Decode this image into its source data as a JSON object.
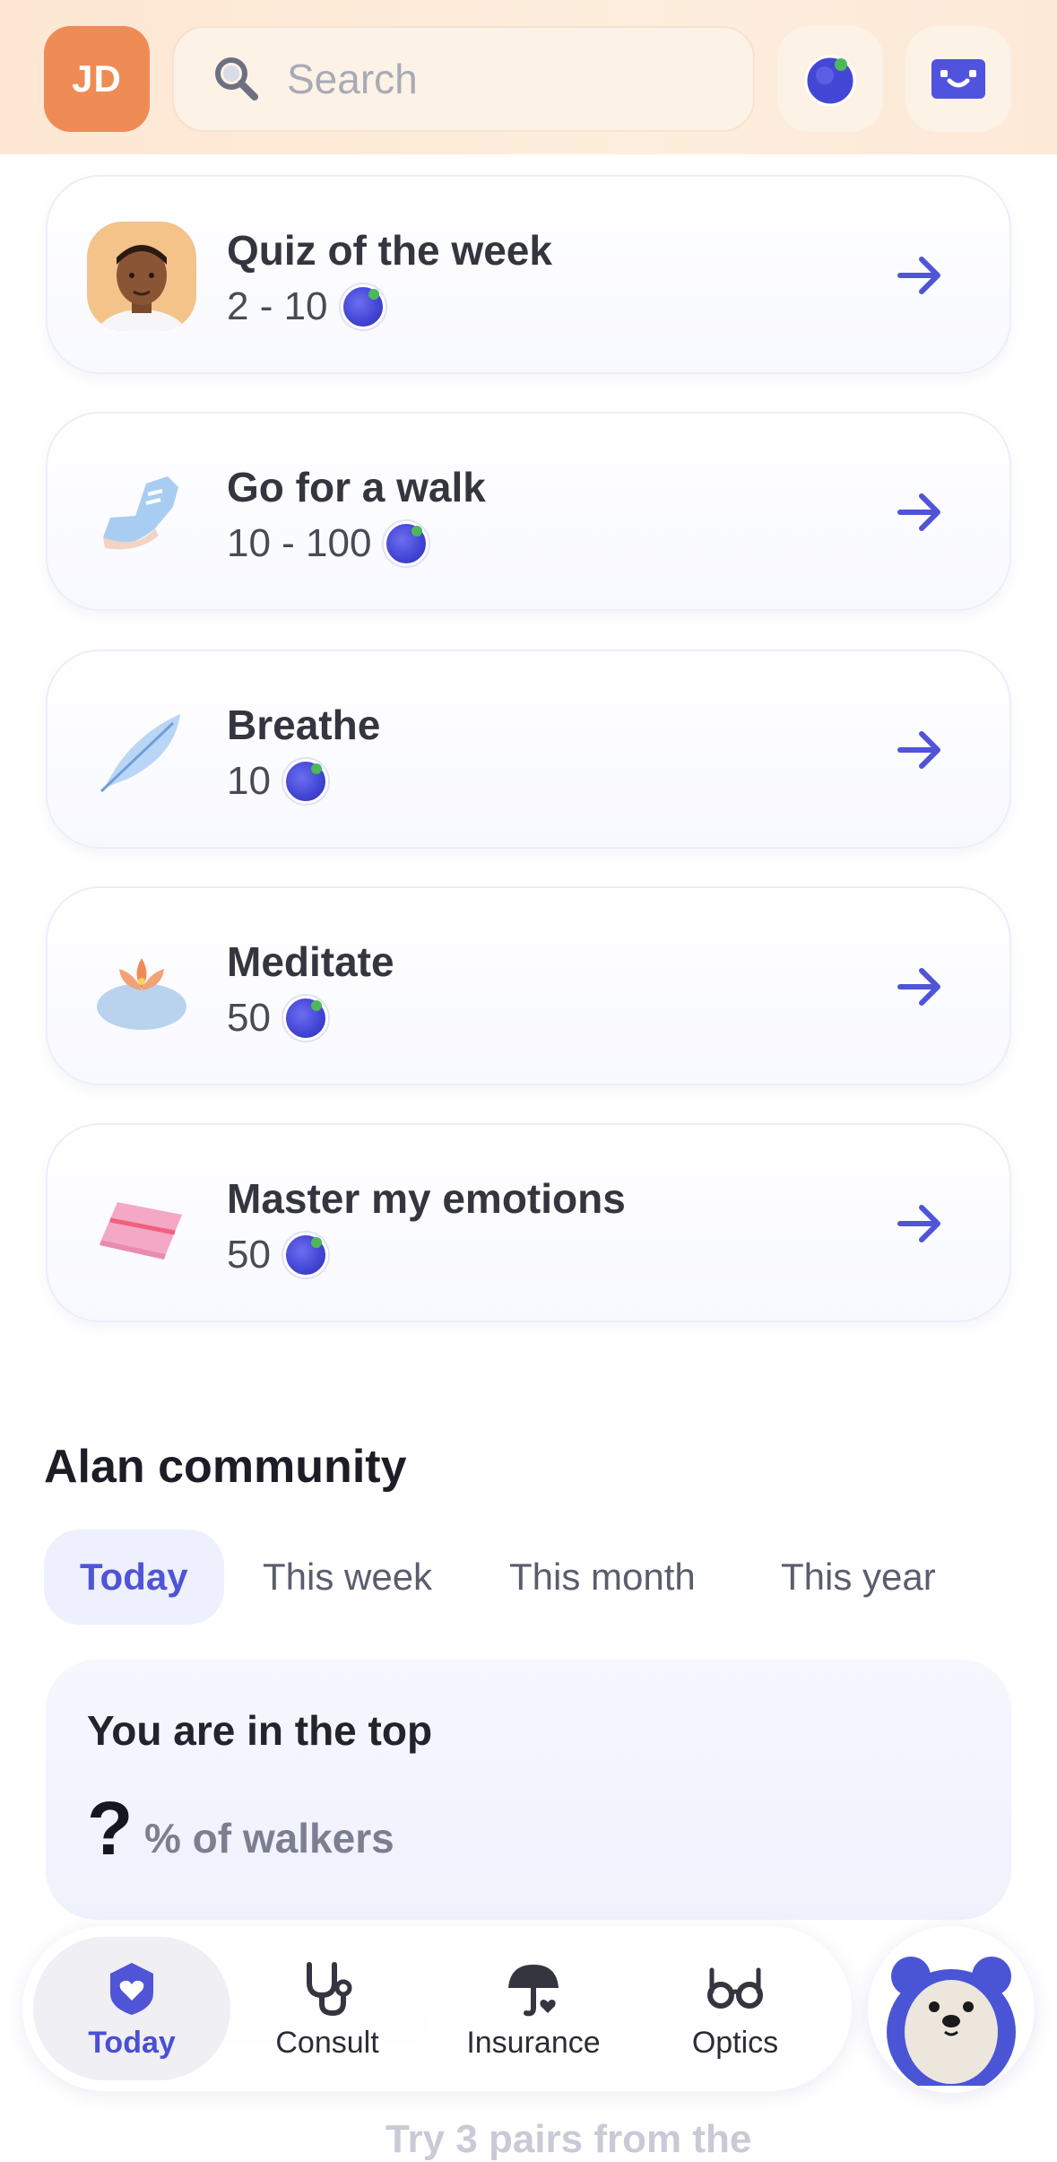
{
  "header": {
    "avatar_initials": "JD",
    "search_placeholder": "Search",
    "icons": [
      "search-icon",
      "berry-icon",
      "bot-icon"
    ]
  },
  "cards": [
    {
      "title": "Quiz of the week",
      "reward": "2 - 10",
      "thumb": "person-avatar"
    },
    {
      "title": "Go for a walk",
      "reward": "10 - 100",
      "thumb": "sneaker"
    },
    {
      "title": "Breathe",
      "reward": "10",
      "thumb": "feather"
    },
    {
      "title": "Meditate",
      "reward": "50",
      "thumb": "lotus"
    },
    {
      "title": "Master my emotions",
      "reward": "50",
      "thumb": "notebook"
    }
  ],
  "community": {
    "title": "Alan community",
    "tabs": [
      "Today",
      "This week",
      "This month",
      "This year"
    ],
    "active_tab": "Today",
    "stat_line1": "You are in the top",
    "stat_value": "?",
    "stat_suffix": "% of walkers"
  },
  "peek_text": "Try 3 pairs from the",
  "nav": {
    "items": [
      {
        "label": "Today",
        "icon": "heart-shield-icon",
        "active": true
      },
      {
        "label": "Consult",
        "icon": "stethoscope-icon",
        "active": false
      },
      {
        "label": "Insurance",
        "icon": "umbrella-heart-icon",
        "active": false
      },
      {
        "label": "Optics",
        "icon": "glasses-icon",
        "active": false
      }
    ]
  },
  "colors": {
    "accent": "#5054d6",
    "avatar": "#ef8b55",
    "header_bg": "#fde7d3"
  }
}
